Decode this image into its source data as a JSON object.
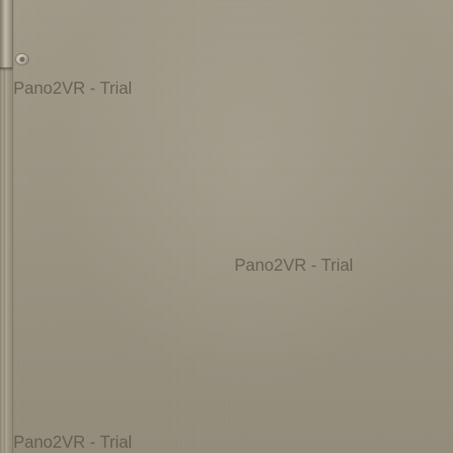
{
  "scene": {
    "description": "",
    "colors": {
      "panel": "#9a9282",
      "edge": "#8a8374",
      "watermark_text": "#504c44"
    }
  },
  "watermarks": [
    {
      "text": "Pano2VR - Trial"
    },
    {
      "text": "Pano2VR - Trial"
    },
    {
      "text": "Pano2VR - Trial"
    }
  ]
}
